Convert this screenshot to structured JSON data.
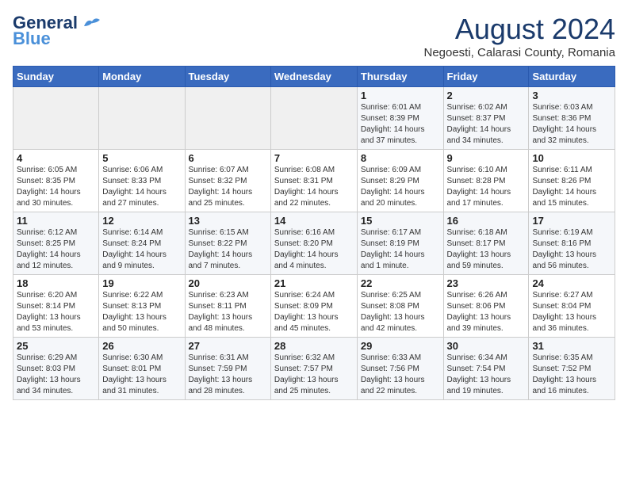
{
  "header": {
    "logo_general": "General",
    "logo_blue": "Blue",
    "month_year": "August 2024",
    "location": "Negoesti, Calarasi County, Romania"
  },
  "days_of_week": [
    "Sunday",
    "Monday",
    "Tuesday",
    "Wednesday",
    "Thursday",
    "Friday",
    "Saturday"
  ],
  "weeks": [
    [
      {
        "day": "",
        "info": ""
      },
      {
        "day": "",
        "info": ""
      },
      {
        "day": "",
        "info": ""
      },
      {
        "day": "",
        "info": ""
      },
      {
        "day": "1",
        "info": "Sunrise: 6:01 AM\nSunset: 8:39 PM\nDaylight: 14 hours\nand 37 minutes."
      },
      {
        "day": "2",
        "info": "Sunrise: 6:02 AM\nSunset: 8:37 PM\nDaylight: 14 hours\nand 34 minutes."
      },
      {
        "day": "3",
        "info": "Sunrise: 6:03 AM\nSunset: 8:36 PM\nDaylight: 14 hours\nand 32 minutes."
      }
    ],
    [
      {
        "day": "4",
        "info": "Sunrise: 6:05 AM\nSunset: 8:35 PM\nDaylight: 14 hours\nand 30 minutes."
      },
      {
        "day": "5",
        "info": "Sunrise: 6:06 AM\nSunset: 8:33 PM\nDaylight: 14 hours\nand 27 minutes."
      },
      {
        "day": "6",
        "info": "Sunrise: 6:07 AM\nSunset: 8:32 PM\nDaylight: 14 hours\nand 25 minutes."
      },
      {
        "day": "7",
        "info": "Sunrise: 6:08 AM\nSunset: 8:31 PM\nDaylight: 14 hours\nand 22 minutes."
      },
      {
        "day": "8",
        "info": "Sunrise: 6:09 AM\nSunset: 8:29 PM\nDaylight: 14 hours\nand 20 minutes."
      },
      {
        "day": "9",
        "info": "Sunrise: 6:10 AM\nSunset: 8:28 PM\nDaylight: 14 hours\nand 17 minutes."
      },
      {
        "day": "10",
        "info": "Sunrise: 6:11 AM\nSunset: 8:26 PM\nDaylight: 14 hours\nand 15 minutes."
      }
    ],
    [
      {
        "day": "11",
        "info": "Sunrise: 6:12 AM\nSunset: 8:25 PM\nDaylight: 14 hours\nand 12 minutes."
      },
      {
        "day": "12",
        "info": "Sunrise: 6:14 AM\nSunset: 8:24 PM\nDaylight: 14 hours\nand 9 minutes."
      },
      {
        "day": "13",
        "info": "Sunrise: 6:15 AM\nSunset: 8:22 PM\nDaylight: 14 hours\nand 7 minutes."
      },
      {
        "day": "14",
        "info": "Sunrise: 6:16 AM\nSunset: 8:20 PM\nDaylight: 14 hours\nand 4 minutes."
      },
      {
        "day": "15",
        "info": "Sunrise: 6:17 AM\nSunset: 8:19 PM\nDaylight: 14 hours\nand 1 minute."
      },
      {
        "day": "16",
        "info": "Sunrise: 6:18 AM\nSunset: 8:17 PM\nDaylight: 13 hours\nand 59 minutes."
      },
      {
        "day": "17",
        "info": "Sunrise: 6:19 AM\nSunset: 8:16 PM\nDaylight: 13 hours\nand 56 minutes."
      }
    ],
    [
      {
        "day": "18",
        "info": "Sunrise: 6:20 AM\nSunset: 8:14 PM\nDaylight: 13 hours\nand 53 minutes."
      },
      {
        "day": "19",
        "info": "Sunrise: 6:22 AM\nSunset: 8:13 PM\nDaylight: 13 hours\nand 50 minutes."
      },
      {
        "day": "20",
        "info": "Sunrise: 6:23 AM\nSunset: 8:11 PM\nDaylight: 13 hours\nand 48 minutes."
      },
      {
        "day": "21",
        "info": "Sunrise: 6:24 AM\nSunset: 8:09 PM\nDaylight: 13 hours\nand 45 minutes."
      },
      {
        "day": "22",
        "info": "Sunrise: 6:25 AM\nSunset: 8:08 PM\nDaylight: 13 hours\nand 42 minutes."
      },
      {
        "day": "23",
        "info": "Sunrise: 6:26 AM\nSunset: 8:06 PM\nDaylight: 13 hours\nand 39 minutes."
      },
      {
        "day": "24",
        "info": "Sunrise: 6:27 AM\nSunset: 8:04 PM\nDaylight: 13 hours\nand 36 minutes."
      }
    ],
    [
      {
        "day": "25",
        "info": "Sunrise: 6:29 AM\nSunset: 8:03 PM\nDaylight: 13 hours\nand 34 minutes."
      },
      {
        "day": "26",
        "info": "Sunrise: 6:30 AM\nSunset: 8:01 PM\nDaylight: 13 hours\nand 31 minutes."
      },
      {
        "day": "27",
        "info": "Sunrise: 6:31 AM\nSunset: 7:59 PM\nDaylight: 13 hours\nand 28 minutes."
      },
      {
        "day": "28",
        "info": "Sunrise: 6:32 AM\nSunset: 7:57 PM\nDaylight: 13 hours\nand 25 minutes."
      },
      {
        "day": "29",
        "info": "Sunrise: 6:33 AM\nSunset: 7:56 PM\nDaylight: 13 hours\nand 22 minutes."
      },
      {
        "day": "30",
        "info": "Sunrise: 6:34 AM\nSunset: 7:54 PM\nDaylight: 13 hours\nand 19 minutes."
      },
      {
        "day": "31",
        "info": "Sunrise: 6:35 AM\nSunset: 7:52 PM\nDaylight: 13 hours\nand 16 minutes."
      }
    ]
  ]
}
